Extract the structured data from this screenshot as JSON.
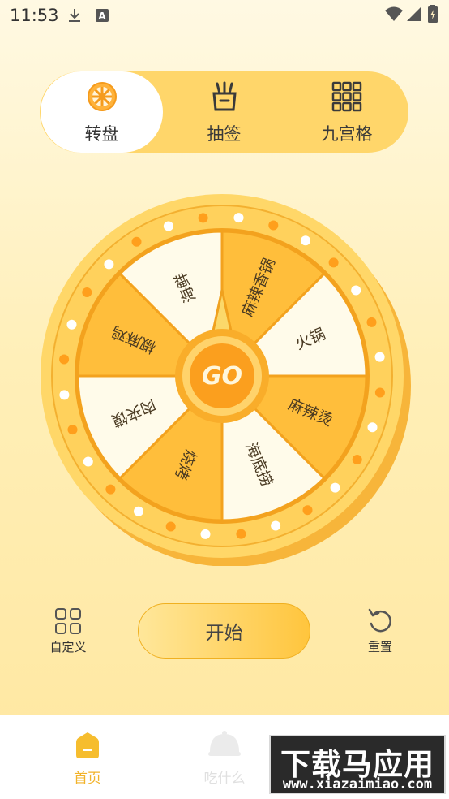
{
  "status_bar": {
    "time": "11:53",
    "left_icons": [
      "download-icon",
      "text-a-icon"
    ],
    "right_icons": [
      "wifi-icon",
      "signal-icon",
      "battery-icon"
    ]
  },
  "mode_tabs": [
    {
      "label": "转盘",
      "icon": "wheel-icon",
      "active": true
    },
    {
      "label": "抽签",
      "icon": "lottery-sticks-icon",
      "active": false
    },
    {
      "label": "九宫格",
      "icon": "grid-icon",
      "active": false
    }
  ],
  "wheel": {
    "center_label": "GO",
    "segments": [
      "麻辣香锅",
      "火锅",
      "麻辣烫",
      "海底捞",
      "烧烤",
      "肉夹馍",
      "椒麻鸡",
      "海鲜"
    ],
    "colors": {
      "orange": "#ffbe3b",
      "cream": "#fffbea",
      "rim": "#ffd15c",
      "border": "#f3a21e",
      "dot": "#ff9f1c"
    }
  },
  "actions": {
    "customize_label": "自定义",
    "start_label": "开始",
    "reset_label": "重置"
  },
  "bottom_nav": {
    "home_label": "首页",
    "eat_label": "吃什么"
  },
  "watermark": {
    "title": "下载马应用",
    "url": "www.xiazaimiao.com"
  },
  "colors": {
    "accent": "#ffc53d",
    "active_nav": "#f2b32b",
    "inactive_nav": "#e6e6e6"
  }
}
